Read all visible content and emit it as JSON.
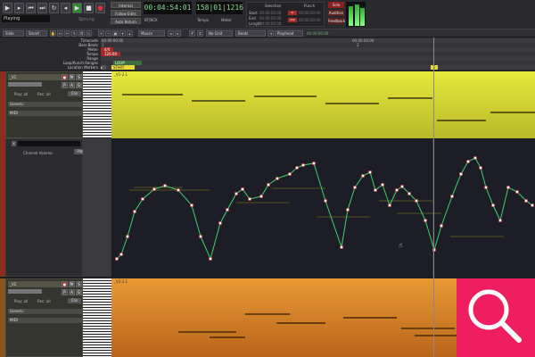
{
  "transport": {
    "status": "Playing",
    "sprung": "Sprung",
    "internal": "Internal",
    "follow_edits": "Follow Edits",
    "auto_return": "Auto Return",
    "clock_main": "00:04:54:01",
    "clock_bbt": "158|01|1216",
    "bbt_caption": "BT|BCK",
    "tempo_label": "Tempo",
    "meter_label": "Meter",
    "selection_label": "Selection",
    "punch_label": "Punch",
    "start_label": "Start",
    "end_label": "End",
    "length_label": "Length",
    "in_label": "In",
    "out_label": "Out",
    "solo_label": "Solo",
    "audition_label": "Audition",
    "feedback_label": "Feedback",
    "timecode_zero": "00:00:00:00"
  },
  "toolbar": {
    "mode": "Slide",
    "snap": "Smart",
    "mouse": "Mouse",
    "grid": "No Grid",
    "beats": "Beats",
    "playhead": "Playhead"
  },
  "rulers": {
    "labels": [
      "Timecode",
      "Bars:Beats",
      "Meter",
      "Tempo",
      "Range",
      "Loop/Punch Ranges",
      "Location Markers"
    ],
    "timecode_ticks": [
      "00:00:00:00",
      "00:00:00:00"
    ],
    "bar_ticks": [
      "1",
      "2"
    ],
    "meter_value": "4/4",
    "tempo_value": "120.00",
    "loop_label": "LOOP",
    "start_marker": "START",
    "end_marker": "END"
  },
  "tracks": [
    {
      "name": "_V1",
      "play": "Play: all",
      "rec": "Rec: all",
      "chn": "Chn",
      "group": "Generic",
      "type": "MIDI",
      "region": "_V1-2.1"
    },
    {
      "name": "_V2",
      "play": "Play: all",
      "rec": "Rec: all",
      "chn": "Chn",
      "group": "Generic",
      "type": "MIDI",
      "region": "_V2-2.1"
    }
  ],
  "automation": {
    "lane_label": "Channel Volume",
    "mode": "Play"
  },
  "colors": {
    "track1": "#e8e83c",
    "track2": "#d98a2a",
    "automation_line": "#3fd36a"
  }
}
